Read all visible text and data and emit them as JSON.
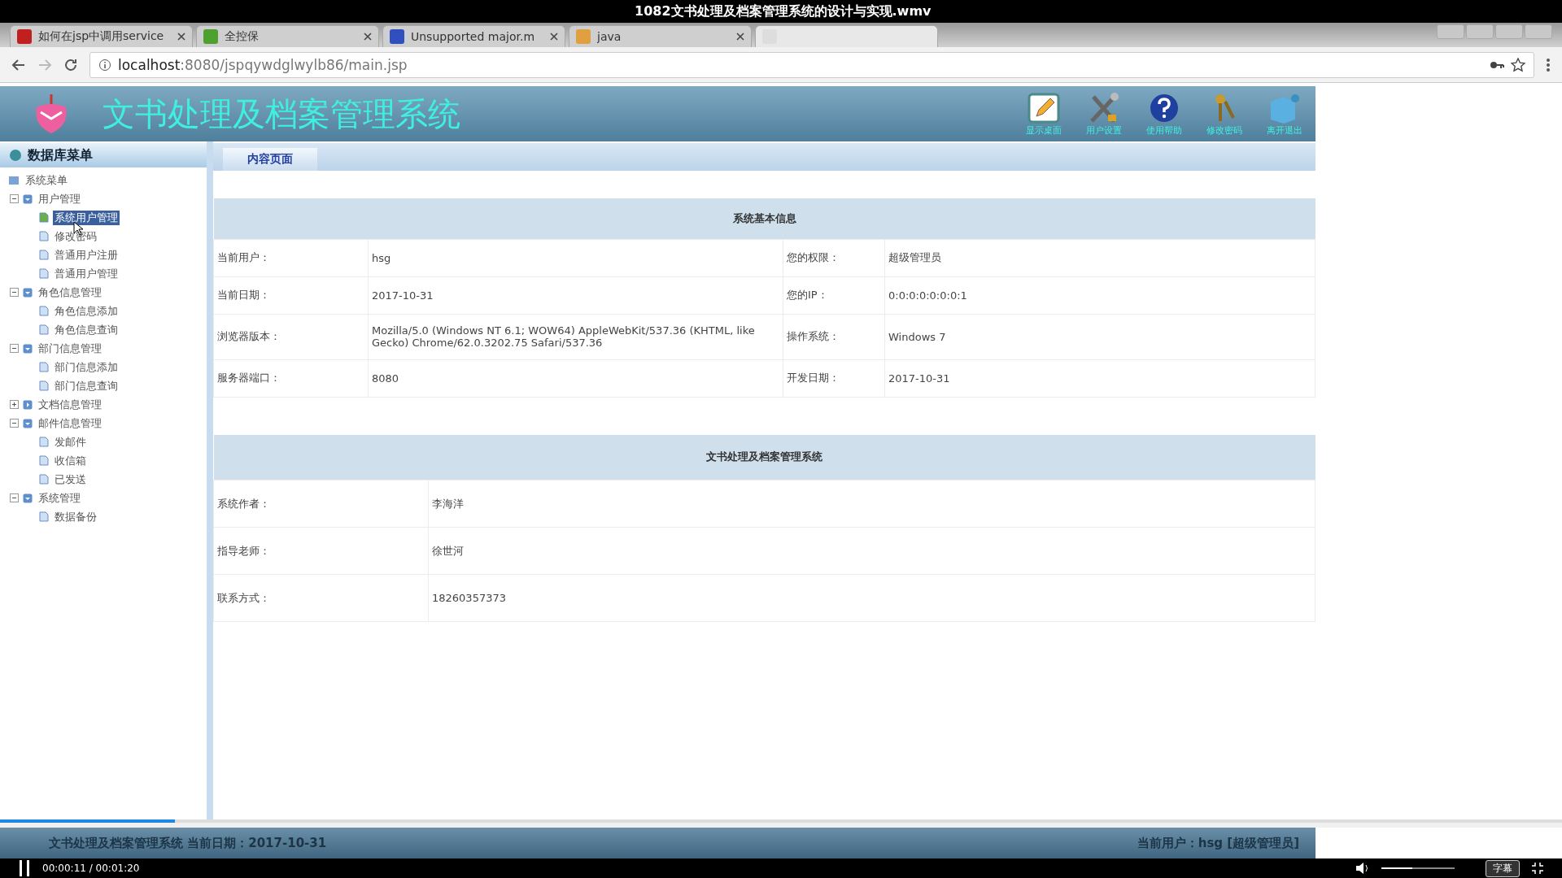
{
  "video": {
    "title": "1082文书处理及档案管理系统的设计与实现.wmv",
    "time": "00:00:11 / 00:01:20",
    "progress": {
      "level": 0.112
    },
    "volume": {
      "level": 0.42
    },
    "subtitle_button": "字幕"
  },
  "browser": {
    "tabs": [
      {
        "label": "如何在jsp中调用service",
        "selected": false
      },
      {
        "label": "全控保",
        "selected": false
      },
      {
        "label": "Unsupported major.m",
        "selected": false
      },
      {
        "label": "java",
        "selected": false
      },
      {
        "selected": true
      }
    ],
    "url_host": "localhost",
    "url_path": ":8080/jspqywdglwylb86/main.jsp"
  },
  "app": {
    "title": "文书处理及档案管理系统",
    "toolbar": [
      {
        "kind": "edit",
        "label": "显示桌面"
      },
      {
        "kind": "tools",
        "label": "用户设置"
      },
      {
        "kind": "help",
        "label": "使用帮助"
      },
      {
        "kind": "key",
        "label": "修改密码"
      },
      {
        "kind": "exit",
        "label": "离开退出"
      }
    ],
    "sidebar": {
      "title": "数据库菜单",
      "root": "系统菜单",
      "tree": [
        {
          "label": "用户管理",
          "expanded": true,
          "children": [
            {
              "label": "系统用户管理",
              "selected": true
            },
            {
              "label": "修改密码",
              "selected": false
            },
            {
              "label": "普通用户注册",
              "selected": false
            },
            {
              "label": "普通用户管理",
              "selected": false
            }
          ]
        },
        {
          "label": "角色信息管理",
          "expanded": true,
          "children": [
            {
              "label": "角色信息添加",
              "selected": false
            },
            {
              "label": "角色信息查询",
              "selected": false
            }
          ]
        },
        {
          "label": "部门信息管理",
          "expanded": true,
          "children": [
            {
              "label": "部门信息添加",
              "selected": false
            },
            {
              "label": "部门信息查询",
              "selected": false
            }
          ]
        },
        {
          "label": "文档信息管理",
          "expanded": false
        },
        {
          "label": "邮件信息管理",
          "expanded": true,
          "children": [
            {
              "label": "发邮件",
              "selected": false
            },
            {
              "label": "收信箱",
              "selected": false
            },
            {
              "label": "已发送",
              "selected": false
            }
          ]
        },
        {
          "label": "系统管理",
          "expanded": true,
          "children": [
            {
              "label": "数据备份",
              "selected": false
            }
          ]
        }
      ]
    },
    "content_tab": "内容页面",
    "info": {
      "title": "系统基本信息",
      "rows": [
        [
          "当前用户：",
          "hsg",
          "您的权限：",
          "超级管理员"
        ],
        [
          "当前日期：",
          "2017-10-31",
          "您的IP：",
          "0:0:0:0:0:0:0:1"
        ],
        [
          "浏览器版本：",
          "Mozilla/5.0 (Windows NT 6.1; WOW64) AppleWebKit/537.36 (KHTML, like Gecko) Chrome/62.0.3202.75 Safari/537.36",
          "操作系统：",
          "Windows 7"
        ],
        [
          "服务器端口：",
          "8080",
          "开发日期：",
          "2017-10-31"
        ]
      ]
    },
    "about": {
      "title": "文书处理及档案管理系统",
      "rows": [
        [
          "系统作者：",
          "李海洋"
        ],
        [
          "指导老师：",
          "徐世河"
        ],
        [
          "联系方式：",
          "18260357373"
        ]
      ]
    },
    "status_left": "文书处理及档案管理系统 当前日期：2017-10-31",
    "status_right": "当前用户：hsg [超级管理员]"
  }
}
